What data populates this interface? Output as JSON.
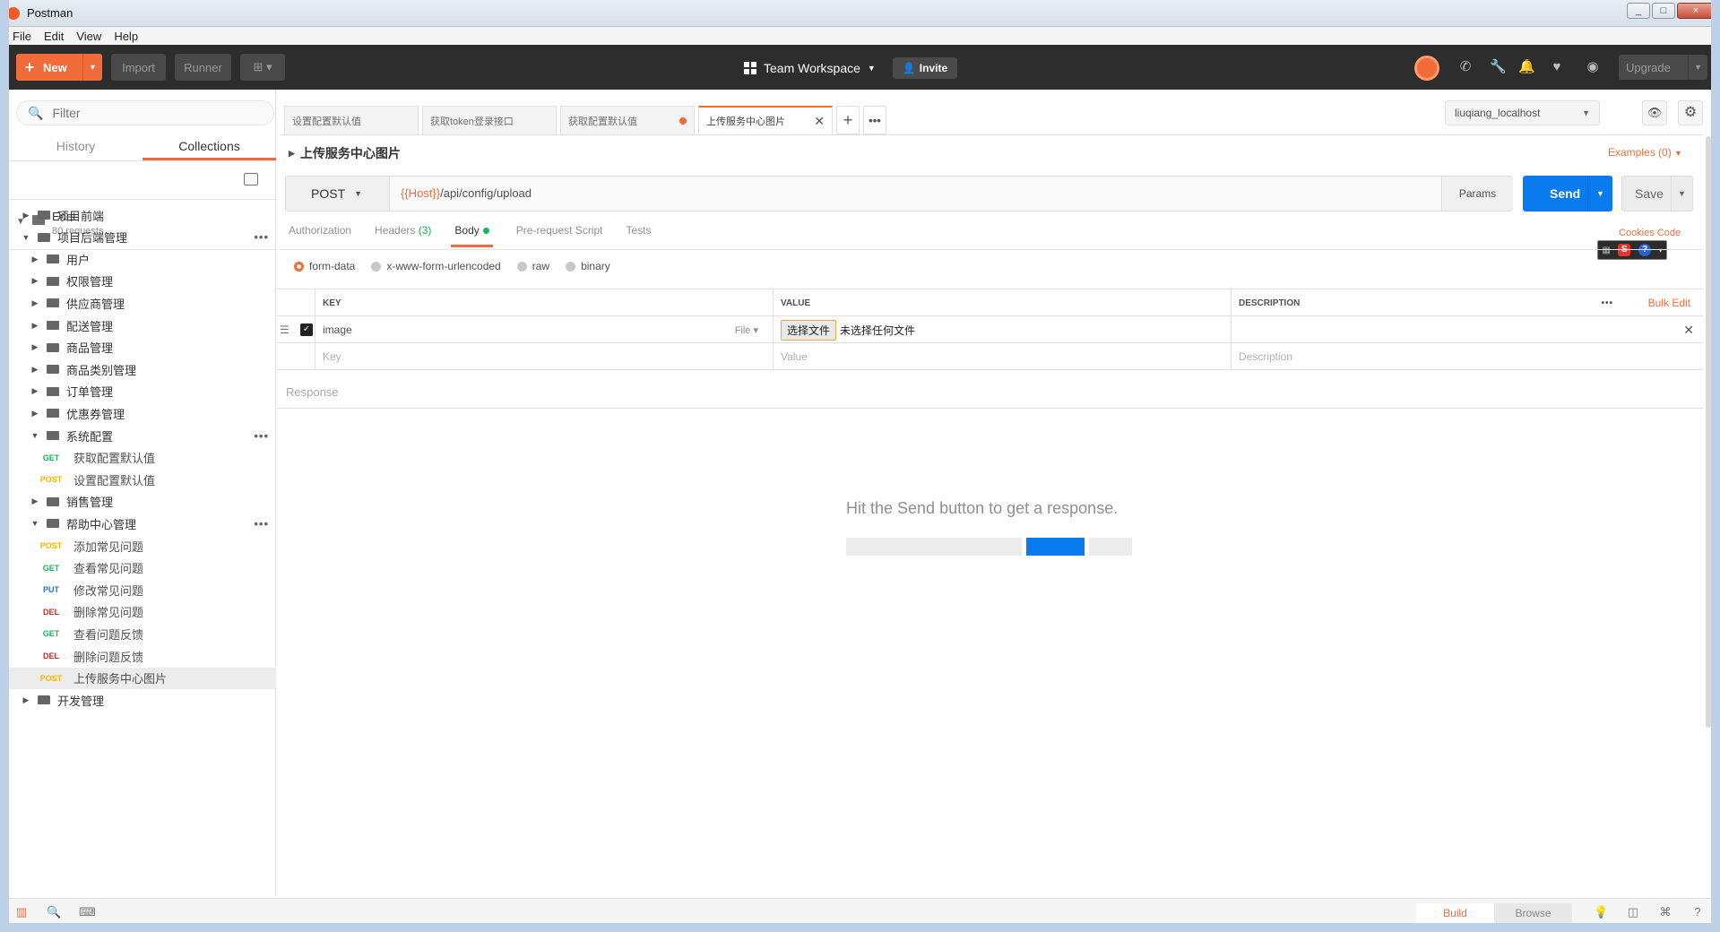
{
  "window": {
    "title": "Postman",
    "controls": [
      "_",
      "□",
      "×"
    ]
  },
  "menu": [
    "File",
    "Edit",
    "View",
    "Help"
  ],
  "header": {
    "new_label": "New",
    "import_label": "Import",
    "runner_label": "Runner",
    "workspace_label": "Team Workspace",
    "invite_label": "Invite",
    "upgrade_label": "Upgrade",
    "accent": "#f26b3a"
  },
  "sidebar": {
    "filter_placeholder": "Filter",
    "tabs": [
      "History",
      "Collections"
    ],
    "active_tab": "Collections",
    "collection": {
      "name": "Enet",
      "count": "80 requests"
    },
    "tree": [
      {
        "type": "folder",
        "label": "项目前端",
        "level": 0,
        "expanded": false
      },
      {
        "type": "folder",
        "label": "项目后端管理",
        "level": 0,
        "expanded": true,
        "menu": "•••"
      },
      {
        "type": "folder",
        "label": "用户",
        "level": 1,
        "expanded": false
      },
      {
        "type": "folder",
        "label": "权限管理",
        "level": 1,
        "expanded": false
      },
      {
        "type": "folder",
        "label": "供应商管理",
        "level": 1,
        "expanded": false
      },
      {
        "type": "folder",
        "label": "配送管理",
        "level": 1,
        "expanded": false
      },
      {
        "type": "folder",
        "label": "商品管理",
        "level": 1,
        "expanded": false
      },
      {
        "type": "folder",
        "label": "商品类别管理",
        "level": 1,
        "expanded": false
      },
      {
        "type": "folder",
        "label": "订单管理",
        "level": 1,
        "expanded": false
      },
      {
        "type": "folder",
        "label": "优惠券管理",
        "level": 1,
        "expanded": false
      },
      {
        "type": "folder",
        "label": "系统配置",
        "level": 1,
        "expanded": true,
        "menu": "•••"
      },
      {
        "type": "request",
        "method": "GET",
        "label": "获取配置默认值"
      },
      {
        "type": "request",
        "method": "POST",
        "label": "设置配置默认值"
      },
      {
        "type": "folder",
        "label": "销售管理",
        "level": 1,
        "expanded": false
      },
      {
        "type": "folder",
        "label": "帮助中心管理",
        "level": 1,
        "expanded": true,
        "menu": "•••"
      },
      {
        "type": "request",
        "method": "POST",
        "label": "添加常见问题"
      },
      {
        "type": "request",
        "method": "GET",
        "label": "查看常见问题"
      },
      {
        "type": "request",
        "method": "PUT",
        "label": "修改常见问题"
      },
      {
        "type": "request",
        "method": "DEL",
        "label": "删除常见问题"
      },
      {
        "type": "request",
        "method": "GET",
        "label": "查看问题反馈"
      },
      {
        "type": "request",
        "method": "DEL",
        "label": "删除问题反馈"
      },
      {
        "type": "request",
        "method": "POST",
        "label": "上传服务中心图片",
        "selected": true
      },
      {
        "type": "folder",
        "label": "开发管理",
        "level": 0,
        "expanded": false
      }
    ]
  },
  "request_tabs": [
    {
      "label": "设置配置默认值",
      "state": ""
    },
    {
      "label": "获取token登录接口",
      "state": ""
    },
    {
      "label": "获取配置默认值",
      "state": "unsaved"
    },
    {
      "label": "上传服务中心图片",
      "state": "active"
    }
  ],
  "environment": {
    "selected": "liuqiang_localhost"
  },
  "request": {
    "title": "上传服务中心图片",
    "examples_label": "Examples (0)",
    "method": "POST",
    "url_var": "{{Host}}",
    "url_path": "/api/config/upload",
    "params_label": "Params",
    "send_label": "Send",
    "save_label": "Save"
  },
  "sub_tabs": {
    "authorization": "Authorization",
    "headers": "Headers",
    "headers_count": "(3)",
    "body": "Body",
    "prerequest": "Pre-request Script",
    "tests": "Tests",
    "cookies": "Cookies",
    "code": "Code"
  },
  "body_types": [
    "form-data",
    "x-www-form-urlencoded",
    "raw",
    "binary"
  ],
  "body_type_selected": "form-data",
  "form_table": {
    "headers": {
      "key": "KEY",
      "value": "VALUE",
      "description": "DESCRIPTION",
      "bulk_edit": "Bulk Edit"
    },
    "rows": [
      {
        "checked": true,
        "key": "image",
        "type": "File",
        "choose_file": "选择文件",
        "file_status": "未选择任何文件",
        "description": ""
      }
    ],
    "placeholders": {
      "key": "Key",
      "value": "Value",
      "description": "Description"
    }
  },
  "response": {
    "label": "Response",
    "hint": "Hit the Send button to get a response."
  },
  "statusbar": {
    "build": "Build",
    "browse": "Browse",
    "active": "Build"
  }
}
